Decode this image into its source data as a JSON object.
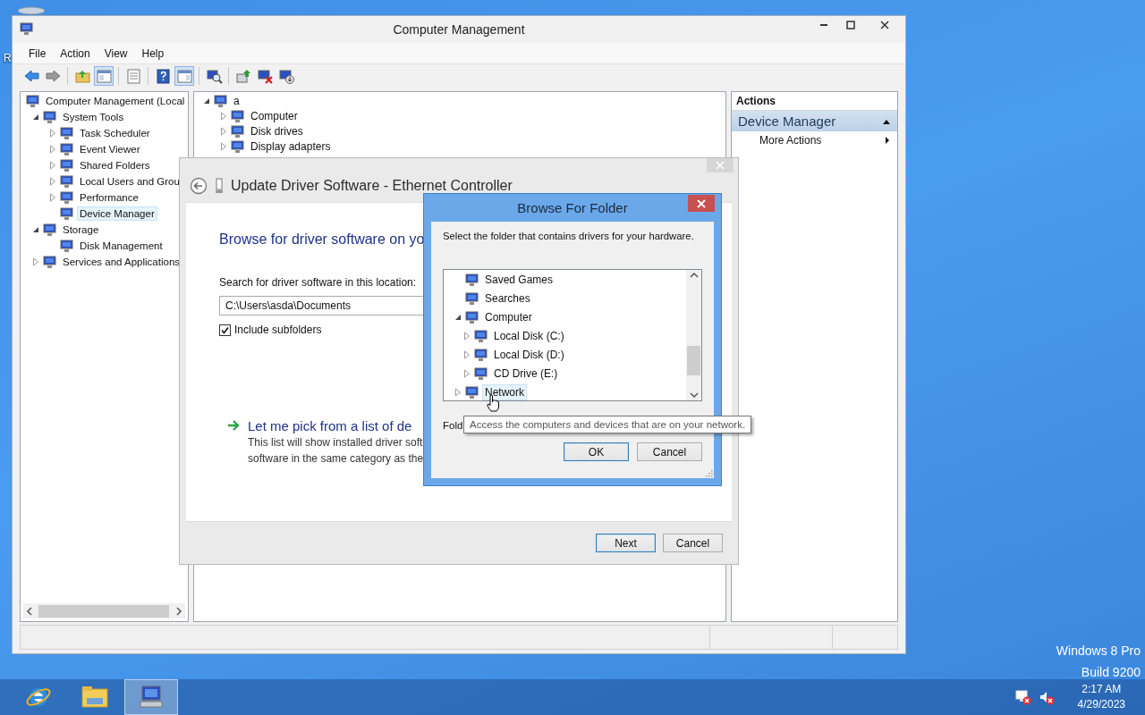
{
  "desktop": {
    "icon_label": "R",
    "edition": "Windows 8 Pro",
    "build": "Build 9200"
  },
  "main_window": {
    "title": "Computer Management",
    "menu": [
      "File",
      "Action",
      "View",
      "Help"
    ],
    "toolbar": [
      [
        {
          "pressed": false
        },
        {
          "pressed": false
        }
      ],
      [
        {
          "pressed": false
        },
        {
          "pressed": true
        }
      ],
      [
        {
          "pressed": false
        }
      ],
      [
        {
          "pressed": false
        },
        {
          "pressed": true
        }
      ],
      [
        {
          "pressed": false
        }
      ],
      [
        {
          "pressed": false
        },
        {
          "pressed": false
        },
        {
          "pressed": false
        }
      ]
    ],
    "console_tree": [
      {
        "label": "Computer Management (Local",
        "selected": false,
        "children": [
          {
            "label": "System Tools",
            "expanded": true,
            "selected": false,
            "children": [
              {
                "label": "Task Scheduler",
                "expanded": false,
                "selected": false
              },
              {
                "label": "Event Viewer",
                "expanded": false,
                "selected": false
              },
              {
                "label": "Shared Folders",
                "expanded": false,
                "selected": false
              },
              {
                "label": "Local Users and Grou",
                "expanded": false,
                "selected": false
              },
              {
                "label": "Performance",
                "expanded": false,
                "selected": false
              },
              {
                "label": "Device Manager",
                "selected": true
              }
            ]
          },
          {
            "label": "Storage",
            "expanded": true,
            "selected": false,
            "children": [
              {
                "label": "Disk Management",
                "selected": false
              }
            ]
          },
          {
            "label": "Services and Applications",
            "expanded": false,
            "selected": false
          }
        ]
      }
    ],
    "device_tree": [
      {
        "label": "a",
        "expanded": true,
        "children": [
          {
            "label": "Computer",
            "expanded": false
          },
          {
            "label": "Disk drives",
            "expanded": false
          },
          {
            "label": "Display adapters",
            "expanded": false
          }
        ]
      }
    ],
    "actions": {
      "header": "Actions",
      "section": {
        "title": "Device Manager",
        "expanded": true
      },
      "items": [
        "More Actions"
      ]
    }
  },
  "driver_dialog": {
    "title": "Update Driver Software - Ethernet Controller",
    "heading": "Browse for driver software on yo",
    "location_label": "Search for driver software in this location:",
    "location_value": "C:\\Users\\asda\\Documents",
    "include_subfolders": {
      "label": "Include subfolders",
      "checked": true
    },
    "pick_option": {
      "title": "Let me pick from a list of de",
      "description_lines": [
        "This list will show installed driver soft",
        "software in the same category as the"
      ]
    },
    "buttons": [
      {
        "label": "Next",
        "default": true
      },
      {
        "label": "Cancel",
        "default": false
      }
    ]
  },
  "browse_dialog": {
    "title": "Browse For Folder",
    "instruction": "Select the folder that contains drivers for your hardware.",
    "tree": [
      {
        "label": "Saved Games",
        "selected": false
      },
      {
        "label": "Searches",
        "selected": false
      },
      {
        "label": "Computer",
        "expanded": true,
        "selected": false,
        "children": [
          {
            "label": "Local Disk (C:)",
            "expanded": false,
            "selected": false
          },
          {
            "label": "Local Disk (D:)",
            "expanded": false,
            "selected": false
          },
          {
            "label": "CD Drive (E:)",
            "expanded": false,
            "selected": false
          }
        ]
      },
      {
        "label": "Network",
        "expanded": false,
        "selected": true
      }
    ],
    "folder_label": "Fold",
    "buttons": [
      {
        "label": "OK",
        "default": true
      },
      {
        "label": "Cancel",
        "default": false
      }
    ]
  },
  "tooltip": "Access the computers and devices that are on your network.",
  "taskbar": {
    "apps": [
      {
        "active": false
      },
      {
        "active": false
      },
      {
        "active": true
      }
    ],
    "time": "2:17 AM",
    "date": "4/29/2023"
  }
}
